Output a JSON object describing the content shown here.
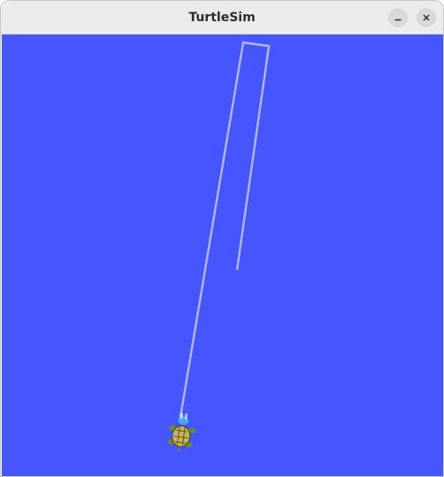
{
  "window": {
    "title": "TurtleSim"
  },
  "canvas": {
    "background_color": "#4556ff",
    "pen_color": "#b3b8ff"
  },
  "turtle": {
    "icon": "turtle-icon",
    "shell_color": "#c8b45a",
    "head_color": "#4aa3ff"
  }
}
